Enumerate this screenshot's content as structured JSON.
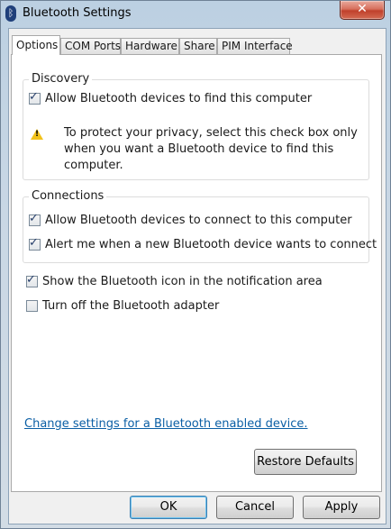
{
  "window": {
    "title": "Bluetooth Settings",
    "close_glyph": "✕",
    "bluetooth_glyph": "ᛒ"
  },
  "tabs": [
    {
      "label": "Options",
      "active": true
    },
    {
      "label": "COM Ports",
      "active": false
    },
    {
      "label": "Hardware",
      "active": false
    },
    {
      "label": "Share",
      "active": false
    },
    {
      "label": "PIM Interface",
      "active": false
    }
  ],
  "discovery": {
    "heading": "Discovery",
    "allow_find_label": "Allow Bluetooth devices to find this computer",
    "allow_find_checked": true,
    "warning_lines": [
      "To protect your privacy, select this check box only",
      "when you want a Bluetooth device to find this",
      "computer."
    ]
  },
  "connections": {
    "heading": "Connections",
    "allow_connect_label": "Allow Bluetooth devices to connect to this computer",
    "allow_connect_checked": true,
    "alert_label": "Alert me when a new Bluetooth device wants to connect",
    "alert_checked": true
  },
  "show_icon": {
    "label": "Show the Bluetooth icon in the notification area",
    "checked": true
  },
  "turn_off": {
    "label": "Turn off the Bluetooth adapter",
    "checked": false
  },
  "change_settings_link": "Change settings for a Bluetooth enabled device.",
  "buttons": {
    "restore_defaults": "Restore Defaults",
    "ok": "OK",
    "cancel": "Cancel",
    "apply": "Apply"
  },
  "check_glyph": "✓",
  "colors": {
    "link": "#0b5fa5",
    "warning": "#f2c21b",
    "close": "#c0402b"
  }
}
